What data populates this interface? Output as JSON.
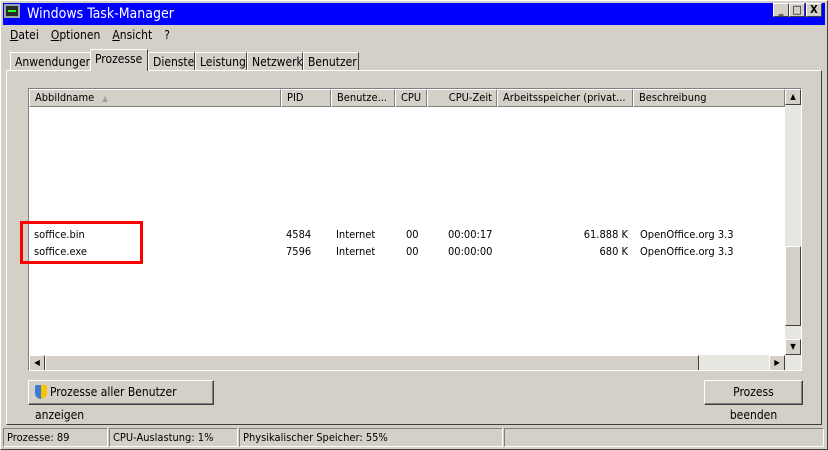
{
  "window": {
    "title": "Windows Task-Manager",
    "controls": [
      "_",
      "□",
      "X"
    ]
  },
  "menu": [
    "Datei",
    "Optionen",
    "Ansicht",
    "?"
  ],
  "tabs": [
    {
      "label": "Anwendungen"
    },
    {
      "label": "Prozesse",
      "active": true
    },
    {
      "label": "Dienste"
    },
    {
      "label": "Leistung"
    },
    {
      "label": "Netzwerk"
    },
    {
      "label": "Benutzer"
    }
  ],
  "table": {
    "columns": [
      "Abbildname",
      "PID",
      "Benutze...",
      "CPU",
      "CPU-Zeit",
      "Arbeitsspeicher (privat...",
      "Beschreibung"
    ],
    "sort_column": "Abbildname",
    "sort_direction": "ascending",
    "rows": [
      [
        "soffice.bin",
        "4584",
        "Internet",
        "00",
        "00:00:17",
        "61.888 K",
        "OpenOffice.org 3.3"
      ],
      [
        "soffice.exe",
        "7596",
        "Internet",
        "00",
        "00:00:00",
        "680 K",
        "OpenOffice.org 3.3"
      ]
    ],
    "highlight_color": "#ff0000"
  },
  "buttons": {
    "show_all": "Prozesse aller Benutzer anzeigen",
    "end_process": "Prozess beenden"
  },
  "status": {
    "processes": "Prozesse: 89",
    "cpu": "CPU-Auslastung: 1%",
    "memory": "Physikalischer Speicher: 55%"
  },
  "colors": {
    "titlebar": "#0000ff",
    "face": "#d4d0c8"
  }
}
